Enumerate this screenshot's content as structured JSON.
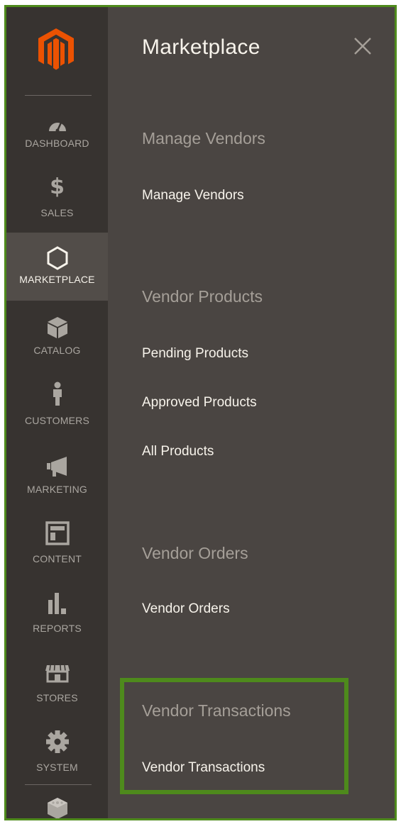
{
  "sidebar": {
    "items": [
      {
        "label": "DASHBOARD",
        "icon": "dashboard-icon"
      },
      {
        "label": "SALES",
        "icon": "dollar-icon"
      },
      {
        "label": "MARKETPLACE",
        "icon": "hexagon-icon",
        "active": true
      },
      {
        "label": "CATALOG",
        "icon": "box-icon"
      },
      {
        "label": "CUSTOMERS",
        "icon": "person-icon"
      },
      {
        "label": "MARKETING",
        "icon": "megaphone-icon"
      },
      {
        "label": "CONTENT",
        "icon": "layout-icon"
      },
      {
        "label": "REPORTS",
        "icon": "bar-chart-icon"
      },
      {
        "label": "STORES",
        "icon": "storefront-icon"
      },
      {
        "label": "SYSTEM",
        "icon": "gear-icon"
      },
      {
        "label": "",
        "icon": "extensions-icon"
      }
    ]
  },
  "panel": {
    "title": "Marketplace",
    "close_icon": "close-icon",
    "sections": [
      {
        "title": "Manage Vendors",
        "links": [
          "Manage Vendors"
        ]
      },
      {
        "title": "Vendor Products",
        "links": [
          "Pending Products",
          "Approved Products",
          "All Products"
        ]
      },
      {
        "title": "Vendor Orders",
        "links": [
          "Vendor Orders"
        ]
      },
      {
        "title": "Vendor Transactions",
        "links": [
          "Vendor Transactions"
        ]
      }
    ]
  },
  "colors": {
    "sidebar_bg": "#373330",
    "panel_bg": "#4a4542",
    "active_bg": "#524d49",
    "logo_orange": "#eb5202",
    "highlight_green": "#4e8a1c"
  }
}
